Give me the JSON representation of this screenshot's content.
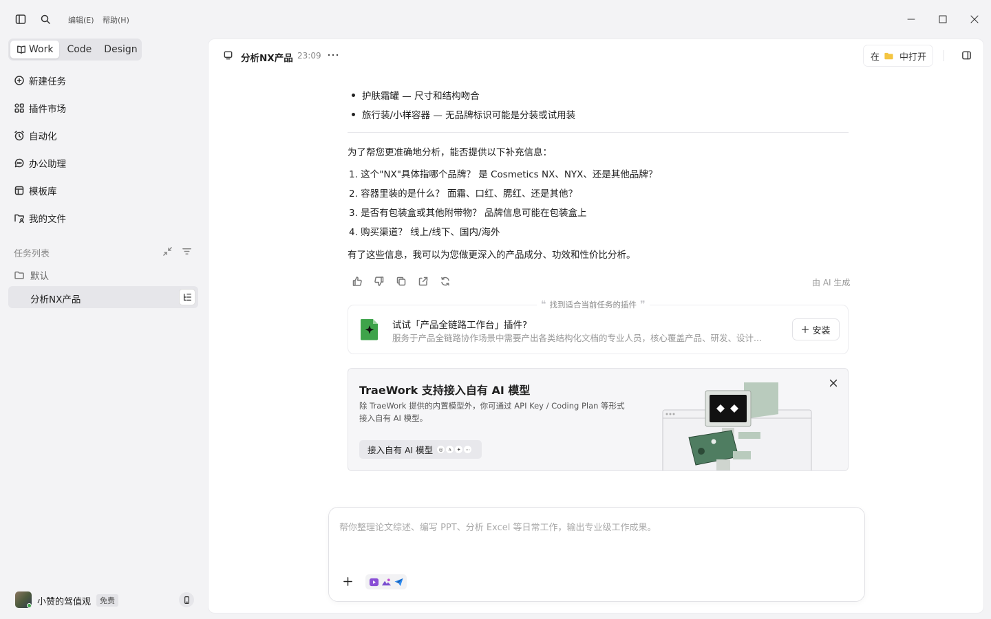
{
  "titlebar": {
    "menu_edit": "编辑(E)",
    "menu_help": "帮助(H)"
  },
  "modes": {
    "work": "Work",
    "code": "Code",
    "design": "Design",
    "active": "Work"
  },
  "nav": {
    "new_task": "新建任务",
    "plugin_market": "插件市场",
    "automation": "自动化",
    "office_assistant": "办公助理",
    "template_library": "模板库",
    "my_files": "我的文件"
  },
  "task_list": {
    "title": "任务列表",
    "folder": "默认",
    "active_task": "分析NX产品"
  },
  "user": {
    "name": "小赞的驾值观",
    "plan_badge": "免费"
  },
  "header": {
    "title": "分析NX产品",
    "time": "23:09",
    "open_in_prefix": "在",
    "open_in_suffix": "中打开"
  },
  "content": {
    "bullets": [
      "护肤霜罐 — 尺寸和结构吻合",
      "旅行装/小样容器 — 无品牌标识可能是分装或试用装"
    ],
    "intro": "为了帮您更准确地分析，能否提供以下补充信息：",
    "questions": [
      "1. 这个\"NX\"具体指哪个品牌？ 是 Cosmetics NX、NYX、还是其他品牌？",
      "2. 容器里装的是什么？ 面霜、口红、腮红、还是其他？",
      "3. 是否有包装盒或其他附带物？ 品牌信息可能在包装盒上",
      "4. 购买渠道？ 线上/线下、国内/海外"
    ],
    "conclusion": "有了这些信息，我可以为您做更深入的产品成分、功效和性价比分析。",
    "ai_label": "由 AI 生成"
  },
  "plugin_suggestion": {
    "caption": "找到适合当前任务的插件",
    "title": "试试「产品全链路工作台」插件?",
    "description": "服务于产品全链路协作场景中需要产出各类结构化文档的专业人员，核心覆盖产品、研发、设计...",
    "install_label": "安装"
  },
  "promo": {
    "title": "TraeWork 支持接入自有 AI 模型",
    "line1": "除 TraeWork 提供的内置模型外，你可通过 API Key / Coding Plan 等形式",
    "line2": "接入自有 AI 模型。",
    "cta_label": "接入自有 AI 模型"
  },
  "composer": {
    "placeholder": "帮你整理论文综述、编写 PPT、分析 Excel 等日常工作，输出专业级工作成果。"
  },
  "colors": {
    "accent_green": "#3ea34a",
    "folder_yellow": "#f4c542",
    "promo_laptop": "#4f7d61"
  }
}
